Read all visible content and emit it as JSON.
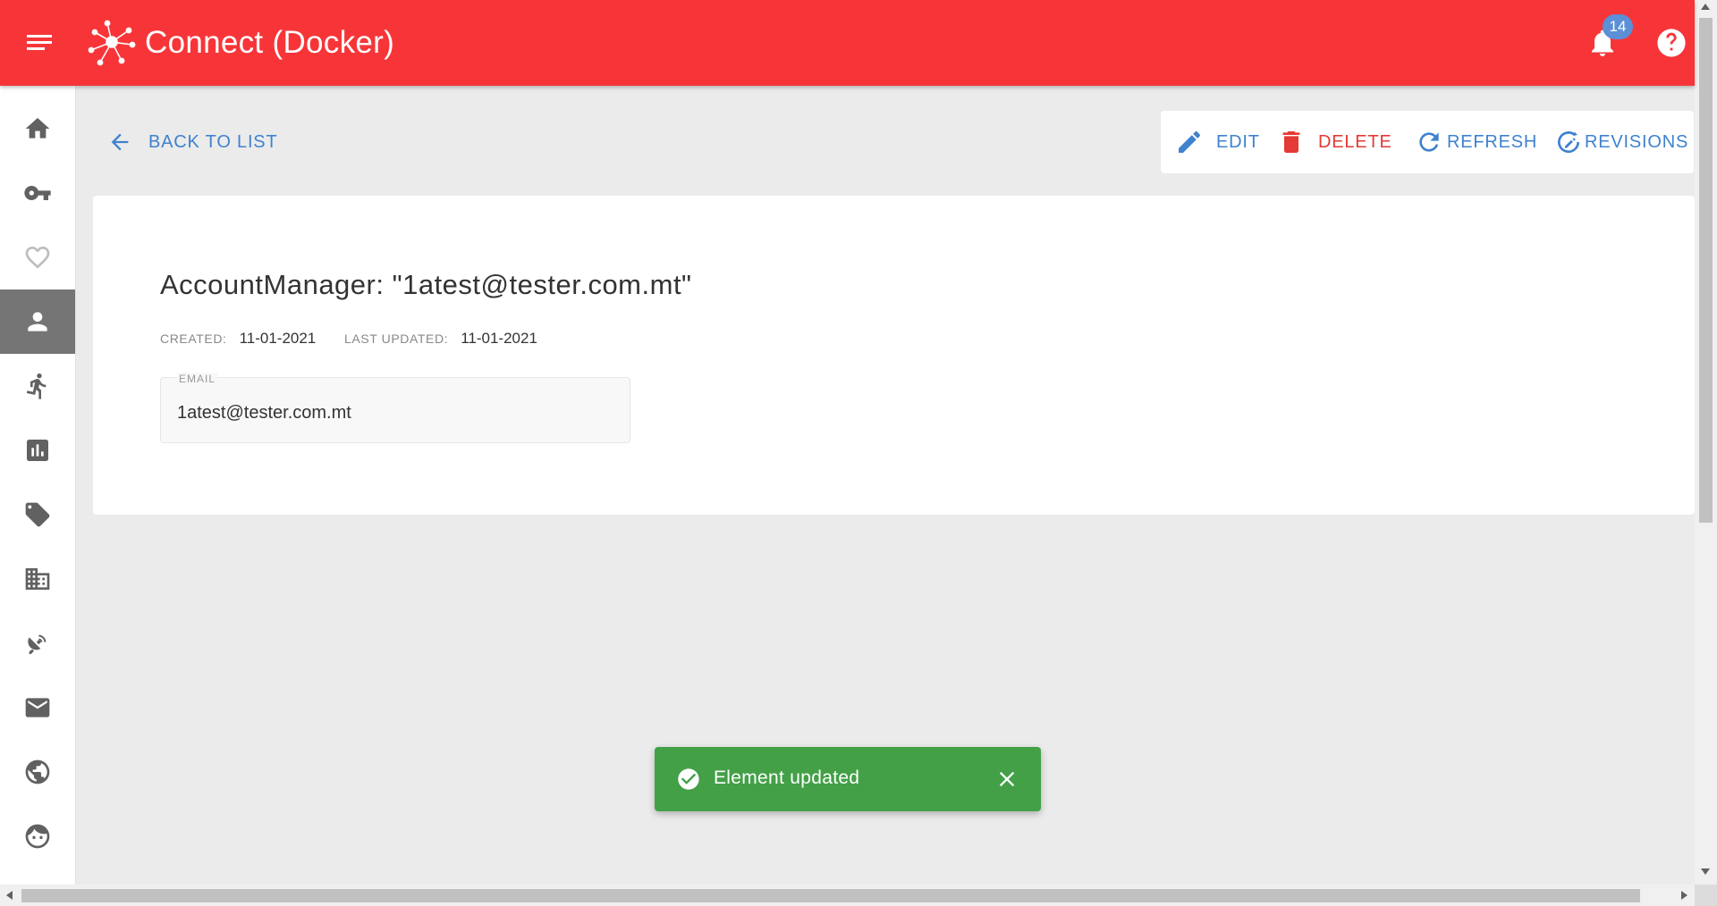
{
  "app": {
    "title": "Connect (Docker)",
    "brand_color": "#f73538"
  },
  "header": {
    "notification_count": "14",
    "icons": [
      "menu-icon",
      "logo-icon",
      "bell-icon",
      "help-icon"
    ]
  },
  "sidebar": {
    "active_index": 3,
    "items": [
      {
        "icon": "home-icon"
      },
      {
        "icon": "key-icon"
      },
      {
        "icon": "heart-icon"
      },
      {
        "icon": "person-icon"
      },
      {
        "icon": "running-person-icon"
      },
      {
        "icon": "bar-chart-icon"
      },
      {
        "icon": "tag-icon"
      },
      {
        "icon": "building-icon"
      },
      {
        "icon": "satellite-dish-icon"
      },
      {
        "icon": "mail-icon"
      },
      {
        "icon": "globe-icon"
      },
      {
        "icon": "face-icon"
      }
    ]
  },
  "toolbar": {
    "back_label": "BACK TO LIST",
    "edit_label": "EDIT",
    "delete_label": "DELETE",
    "refresh_label": "REFRESH",
    "revisions_label": "REVISIONS",
    "accent_color": "#3f82cf",
    "danger_color": "#e53935"
  },
  "record": {
    "title": "AccountManager: \"1atest@tester.com.mt\"",
    "created_label": "CREATED:",
    "created_value": "11-01-2021",
    "updated_label": "LAST UPDATED:",
    "updated_value": "11-01-2021",
    "email_label": "EMAIL",
    "email_value": "1atest@tester.com.mt"
  },
  "snackbar": {
    "message": "Element updated",
    "color": "#43a047"
  }
}
